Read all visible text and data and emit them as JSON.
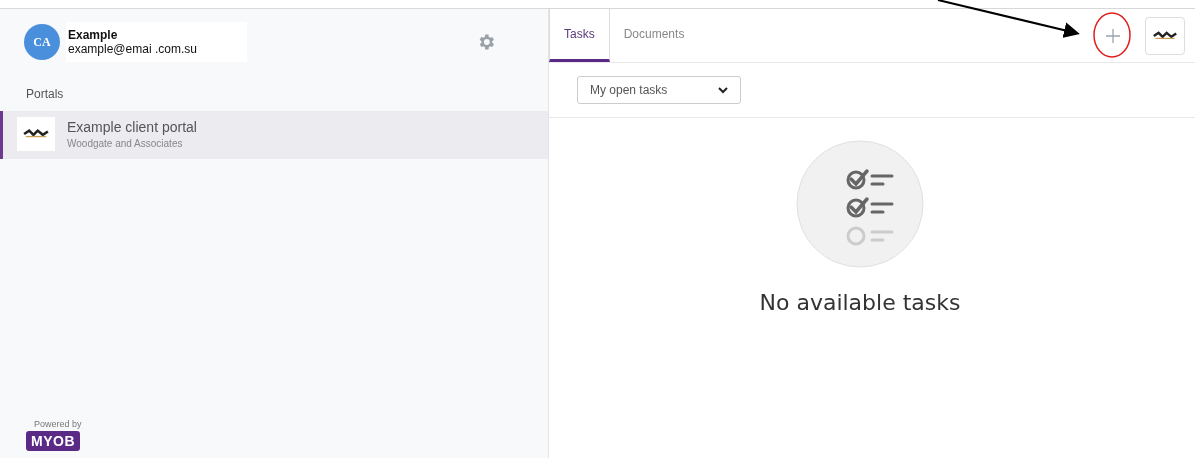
{
  "user": {
    "initials": "CA",
    "name": "Example",
    "email": "example@emai .com.su"
  },
  "sidebar": {
    "section_label": "Portals",
    "items": [
      {
        "title": "Example client portal",
        "subtitle": "Woodgate and Associates",
        "selected": true
      }
    ],
    "footer": {
      "caption": "Powered by",
      "logo_text": "MYOB"
    }
  },
  "tabs": [
    {
      "label": "Tasks",
      "selected": true
    },
    {
      "label": "Documents",
      "selected": false
    }
  ],
  "filter": {
    "value": "My open tasks"
  },
  "empty_state": {
    "message": "No available tasks"
  },
  "annotation": {
    "kind": "arrow-circle"
  }
}
